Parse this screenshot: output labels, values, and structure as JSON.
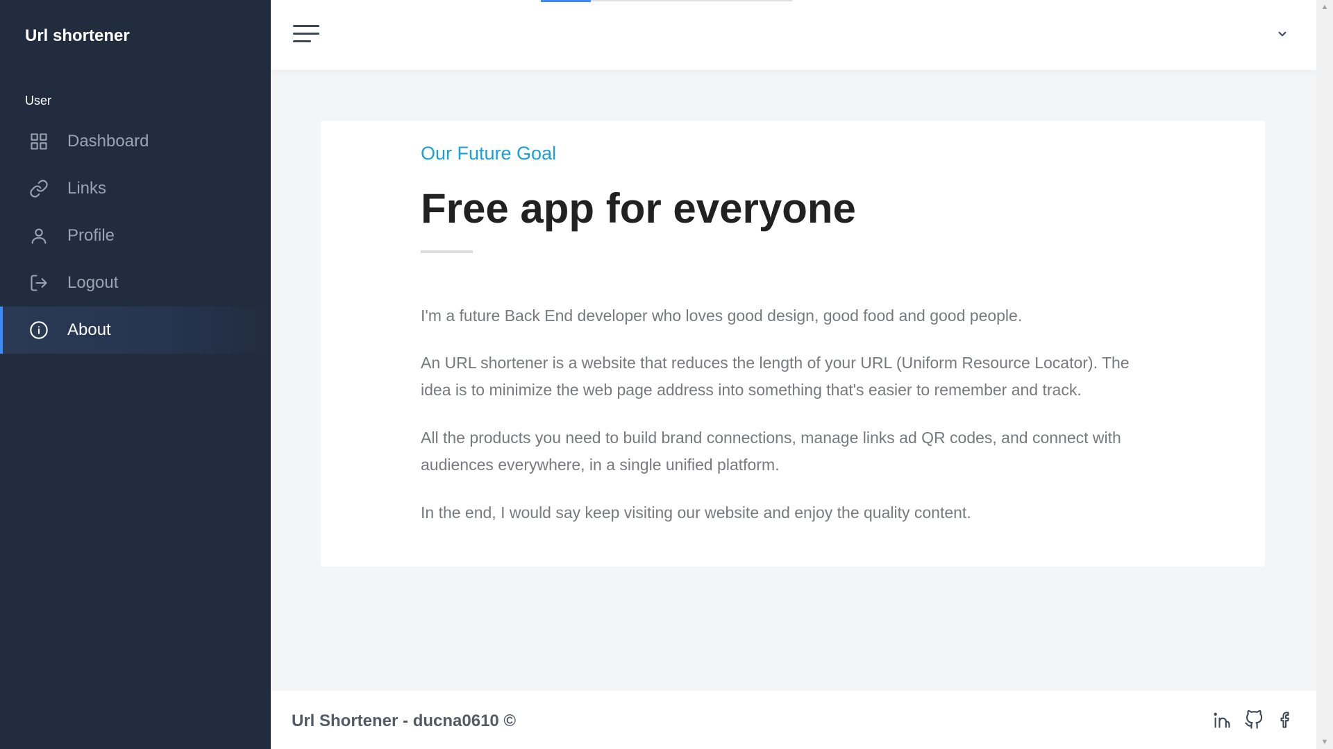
{
  "sidebar": {
    "brand": "Url shortener",
    "heading": "User",
    "items": [
      {
        "label": "Dashboard",
        "icon": "grid-icon"
      },
      {
        "label": "Links",
        "icon": "link-icon"
      },
      {
        "label": "Profile",
        "icon": "user-icon"
      },
      {
        "label": "Logout",
        "icon": "logout-icon"
      },
      {
        "label": "About",
        "icon": "info-icon",
        "active": true
      }
    ]
  },
  "topbar": {
    "menu_icon": "hamburger-icon",
    "user_menu_icon": "chevron-down-icon",
    "loading_progress": 0.2
  },
  "about": {
    "eyebrow": "Our Future Goal",
    "title": "Free app for everyone",
    "paragraphs": [
      "I'm a future Back End developer who loves good design, good food and good people.",
      "An URL shortener is a website that reduces the length of your URL (Uniform Resource Locator). The idea is to minimize the web page address into something that's easier to remember and track.",
      "All the products you need to build brand connections, manage links ad QR codes, and connect with audiences everywhere, in a single unified platform.",
      "In the end, I would say keep visiting our website and enjoy the quality content."
    ]
  },
  "footer": {
    "text": "Url Shortener - ducna0610 ©",
    "social": [
      "linkedin-icon",
      "github-icon",
      "facebook-icon"
    ]
  },
  "colors": {
    "sidebar_bg": "#212d3e",
    "accent": "#3d8bf8",
    "eyebrow": "#1aa0d8",
    "text_muted": "#77797d"
  }
}
